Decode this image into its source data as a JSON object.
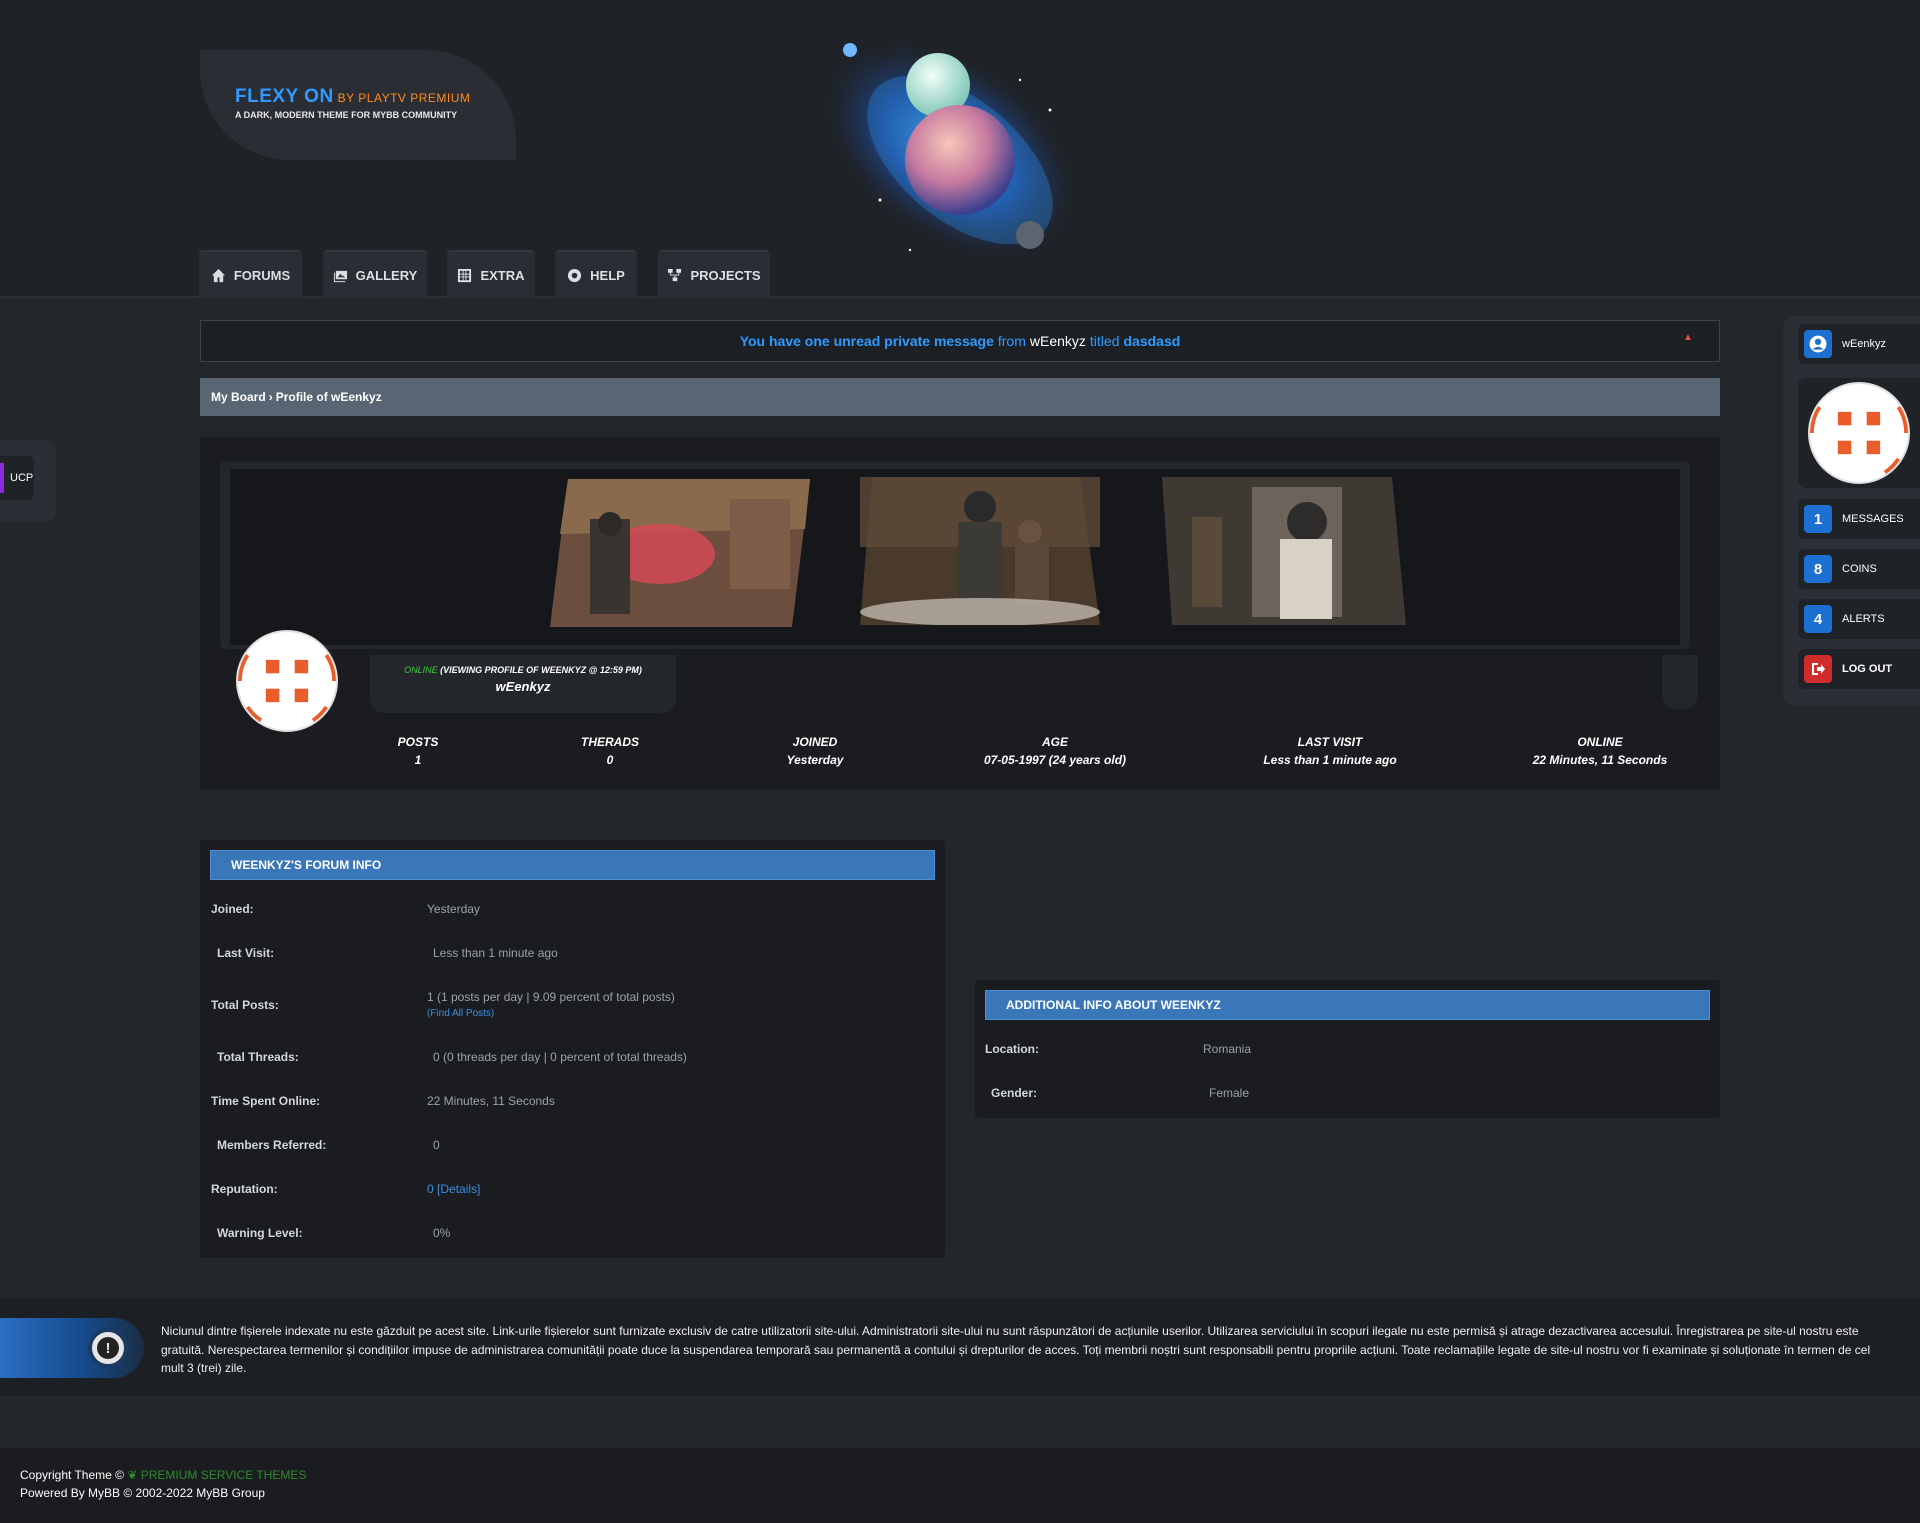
{
  "header": {
    "logo_title": "FLEXY ON",
    "logo_by": "BY PLAYTV PREMIUM",
    "logo_subtitle": "A DARK, MODERN THEME FOR MYBB COMMUNITY"
  },
  "nav": {
    "tabs": [
      {
        "label": "FORUMS",
        "icon": "home-icon"
      },
      {
        "label": "GALLERY",
        "icon": "gallery-icon"
      },
      {
        "label": "EXTRA",
        "icon": "grid-icon"
      },
      {
        "label": "HELP",
        "icon": "help-icon"
      },
      {
        "label": "PROJECTS",
        "icon": "sitemap-icon"
      }
    ]
  },
  "pm_notice": {
    "text1": "You have one unread private message",
    "from_label": "from",
    "from_user": "wEenkyz",
    "titled_label": "titled",
    "subject": "dasdasd"
  },
  "breadcrumb": {
    "home": "My Board",
    "separator": "›",
    "current": "Profile of wEenkyz"
  },
  "profile": {
    "online_status": "ONLINE",
    "activity": "(VIEWING PROFILE OF WEENKYZ @ 12:59 PM)",
    "username": "wEenkyz",
    "stats": [
      {
        "label": "POSTS",
        "value": "1"
      },
      {
        "label": "THERADS",
        "value": "0"
      },
      {
        "label": "JOINED",
        "value": "Yesterday"
      },
      {
        "label": "AGE",
        "value": "07-05-1997 (24 years old)"
      },
      {
        "label": "LAST VISIT",
        "value": "Less than 1 minute ago"
      },
      {
        "label": "ONLINE",
        "value": "22 Minutes, 11 Seconds"
      }
    ]
  },
  "forum_info": {
    "title": "WEENKYZ'S FORUM INFO",
    "rows": [
      {
        "label": "Joined:",
        "value": "Yesterday"
      },
      {
        "label": "Last Visit:",
        "value": "Less than 1 minute ago"
      },
      {
        "label": "Total Posts:",
        "value": "1 (1 posts per day | 9.09 percent of total posts)",
        "sublink": "(Find All Posts)"
      },
      {
        "label": "Total Threads:",
        "value": "0 (0 threads per day | 0 percent of total threads)"
      },
      {
        "label": "Time Spent Online:",
        "value": "22 Minutes, 11 Seconds"
      },
      {
        "label": "Members Referred:",
        "value": "0"
      },
      {
        "label": "Reputation:",
        "value": "0",
        "link": "[Details]"
      },
      {
        "label": "Warning Level:",
        "value": "0%"
      }
    ]
  },
  "additional_info": {
    "title": "ADDITIONAL INFO ABOUT WEENKYZ",
    "rows": [
      {
        "label": "Location:",
        "value": "Romania"
      },
      {
        "label": "Gender:",
        "value": "Female"
      }
    ]
  },
  "disclaimer": "Niciunul dintre fișierele indexate nu este găzduit pe acest site. Link-urile fișierelor sunt furnizate exclusiv de catre utilizatorii site-ului. Administratorii site-ului nu sunt răspunzători de acțiunile userilor. Utilizarea serviciului în scopuri ilegale nu este permisă și atrage dezactivarea accesului. Înregistrarea pe site-ul nostru este gratuită. Nerespectarea termenilor și condițiilor impuse de administrarea comunității poate duce la suspendarea temporară sau permanentă a contului și drepturilor de acces. Toți membrii noștri sunt responsabili pentru propriile acțiuni. Toate reclamațiile legate de site-ul nostru vor fi examinate și soluționate în termen de cel mult 3 (trei) zile.",
  "footer": {
    "copyright": "Copyright Theme ©",
    "premium": "PREMIUM SERVICE THEMES",
    "powered": "Powered By MyBB © 2002-2022 MyBB Group"
  },
  "ucp": {
    "label": "UCP"
  },
  "user_sidebar": {
    "username": "wEenkyz",
    "messages_count": "1",
    "messages_label": "MESSAGES",
    "coins_count": "8",
    "coins_label": "COINS",
    "alerts_count": "4",
    "alerts_label": "ALERTS",
    "logout_label": "LOG OUT"
  },
  "colors": {
    "accent_blue": "#3977b9",
    "link_blue": "#2f9bff",
    "online_green": "#3ac93a",
    "logo_orange": "#ff8c1a",
    "avatar_orange": "#e85d2a"
  }
}
